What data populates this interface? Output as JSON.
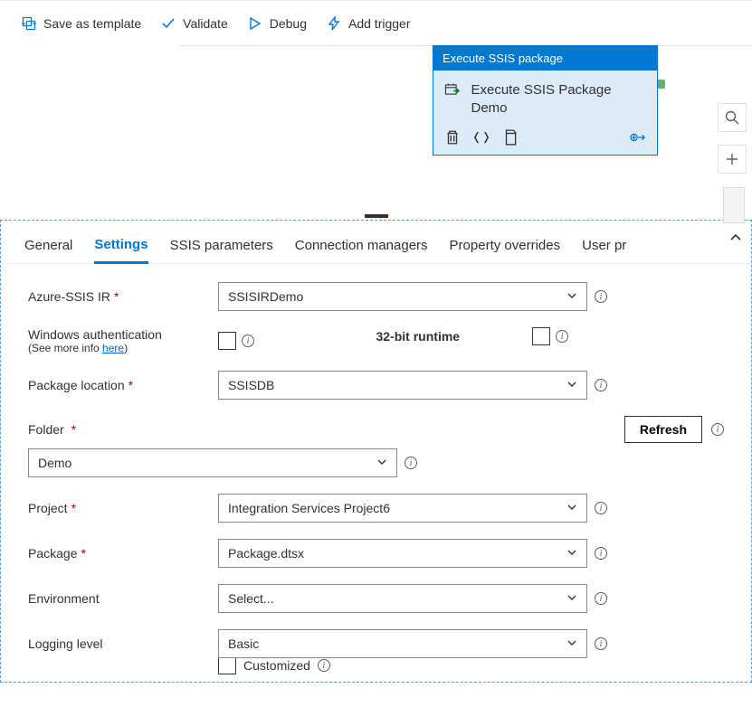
{
  "toolbar": {
    "saveTemplate": "Save as template",
    "validate": "Validate",
    "debug": "Debug",
    "addTrigger": "Add trigger"
  },
  "activity": {
    "header": "Execute SSIS package",
    "title": "Execute SSIS Package Demo"
  },
  "tabs": {
    "general": "General",
    "settings": "Settings",
    "ssisParams": "SSIS parameters",
    "connManagers": "Connection managers",
    "propOverrides": "Property overrides",
    "userProps": "User pr"
  },
  "form": {
    "azureIrLabel": "Azure-SSIS IR",
    "azureIrValue": "SSISIRDemo",
    "winAuthLabel": "Windows authentication",
    "winAuthSub": "(See more info ",
    "winAuthLink": "here",
    "winAuthSubEnd": ")",
    "runtimeLabel": "32-bit runtime",
    "pkgLocationLabel": "Package location",
    "pkgLocationValue": "SSISDB",
    "folderLabel": "Folder",
    "folderValue": "Demo",
    "refresh": "Refresh",
    "projectLabel": "Project",
    "projectValue": "Integration Services Project6",
    "packageLabel": "Package",
    "packageValue": "Package.dtsx",
    "envLabel": "Environment",
    "envValue": "Select...",
    "logLabel": "Logging level",
    "logValue": "Basic",
    "customized": "Customized"
  }
}
